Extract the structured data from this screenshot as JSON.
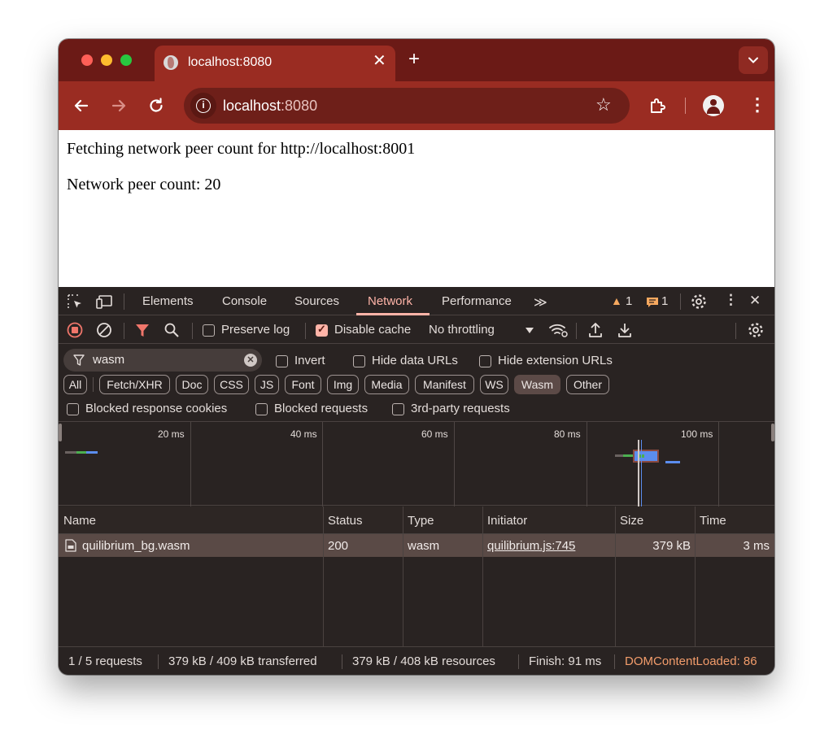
{
  "browser": {
    "tab_title": "localhost:8080",
    "url_host": "localhost",
    "url_port": ":8080"
  },
  "page": {
    "line1": "Fetching network peer count for http://localhost:8001",
    "line2": "Network peer count: 20"
  },
  "devtools": {
    "tabs": [
      "Elements",
      "Console",
      "Sources",
      "Network",
      "Performance"
    ],
    "active_tab": "Network",
    "warning_count": "1",
    "issue_count": "1",
    "toolbar": {
      "preserve_log": "Preserve log",
      "disable_cache": "Disable cache",
      "throttling": "No throttling"
    },
    "filter": {
      "value": "wasm",
      "invert": "Invert",
      "hide_data_urls": "Hide data URLs",
      "hide_extension_urls": "Hide extension URLs"
    },
    "type_chips": [
      "All",
      "Fetch/XHR",
      "Doc",
      "CSS",
      "JS",
      "Font",
      "Img",
      "Media",
      "Manifest",
      "WS",
      "Wasm",
      "Other"
    ],
    "active_chip": "Wasm",
    "checkbox_row": {
      "blocked_response_cookies": "Blocked response cookies",
      "blocked_requests": "Blocked requests",
      "third_party_requests": "3rd-party requests"
    },
    "overview_ticks": [
      "20 ms",
      "40 ms",
      "60 ms",
      "80 ms",
      "100 ms"
    ],
    "columns": [
      "Name",
      "Status",
      "Type",
      "Initiator",
      "Size",
      "Time"
    ],
    "rows": [
      {
        "name": "quilibrium_bg.wasm",
        "status": "200",
        "type": "wasm",
        "initiator": "quilibrium.js:745",
        "size": "379 kB",
        "time": "3 ms"
      }
    ],
    "status": {
      "requests": "1 / 5 requests",
      "transferred": "379 kB / 409 kB transferred",
      "resources": "379 kB / 408 kB resources",
      "finish": "Finish: 91 ms",
      "dom_content_loaded": "DOMContentLoaded: 86"
    }
  }
}
